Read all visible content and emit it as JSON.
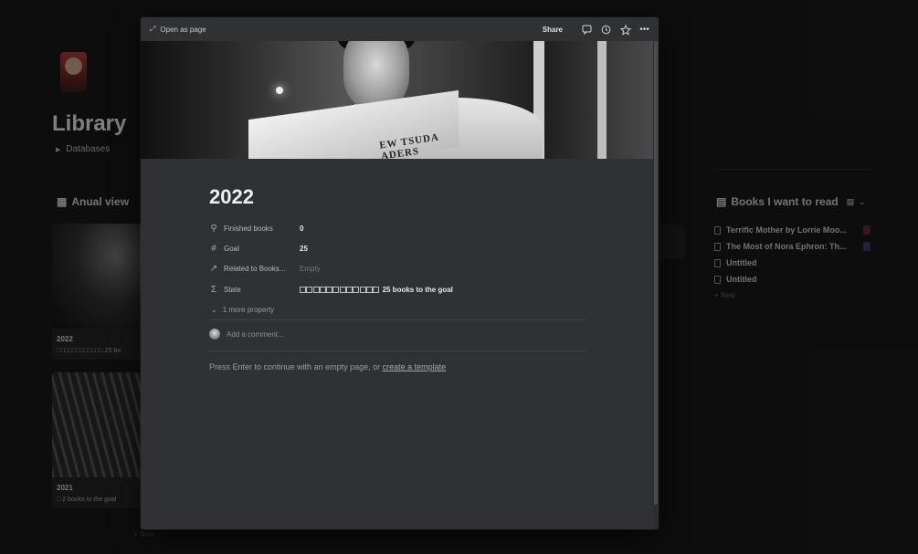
{
  "background": {
    "page_title": "Library",
    "databases_toggle": "Databases",
    "annual_view_title": "Anual view",
    "cards": [
      {
        "title": "2022",
        "state": "□□□□□□□□□□□□ 25 bo"
      },
      {
        "title": "2021",
        "state": "□ 2 books to the goal"
      }
    ],
    "new_label": "+ New",
    "books_list": {
      "title": "Books I want to read",
      "items": [
        "Terrific Mother by Lorrie Moo...",
        "The Most of Nora Ephron: Th...",
        "Untitled",
        "Untitled"
      ],
      "new_label": "+ New"
    }
  },
  "modal": {
    "open_as_page": "Open as page",
    "share": "Share",
    "icons": [
      "comment-icon",
      "history-icon",
      "star-icon",
      "more-icon"
    ],
    "title": "2022",
    "properties": [
      {
        "icon": "search-icon",
        "glyph": "⚲",
        "key": "Finished books",
        "value": "0"
      },
      {
        "icon": "hash-icon",
        "glyph": "#",
        "key": "Goal",
        "value": "25"
      },
      {
        "icon": "relation-arrow-icon",
        "glyph": "↗",
        "key": "Related to Books...",
        "value": "Empty"
      },
      {
        "icon": "formula-sigma-icon",
        "glyph": "Σ",
        "key": "State",
        "value": "25 books to the goal",
        "boxes": 12
      }
    ],
    "more_property": "1 more property",
    "comment_placeholder": "Add a comment...",
    "enter_hint": "Press Enter to continue with an empty page, or ",
    "create_template_link": "create a template",
    "cover_text": "EW TSUDA\nADERS"
  }
}
